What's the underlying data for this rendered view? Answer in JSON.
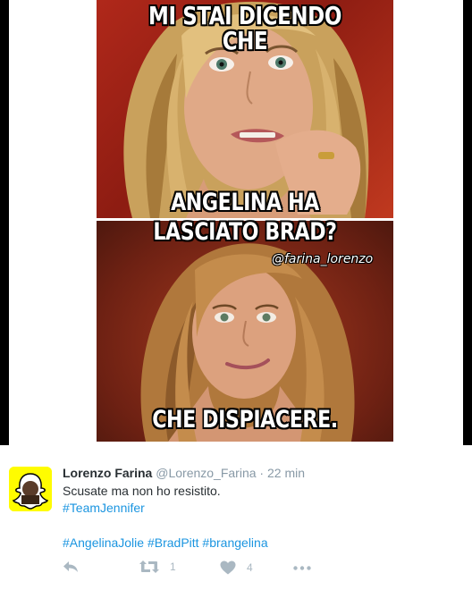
{
  "meme": {
    "caption_top": "MI STAI DICENDO CHE",
    "caption_mid_1": "ANGELINA HA",
    "caption_mid_2": "LASCIATO BRAD?",
    "caption_bottom": "CHE DISPIACERE.",
    "watermark": "@farina_lorenzo"
  },
  "tweet": {
    "author_name": "Lorenzo Farina",
    "author_handle": "@Lorenzo_Farina",
    "separator": "·",
    "timestamp": "22 min",
    "text": "Scusate ma non ho resistito.",
    "hashtag_line_1": "#TeamJennifer",
    "hashtag_line_2": "#AngelinaJolie #BradPitt #brangelina",
    "avatar_icon": "snapchat-ghost-icon",
    "avatar_color": "#fffc00"
  },
  "actions": {
    "reply_icon": "reply-icon",
    "retweet_icon": "retweet-icon",
    "retweet_count": "1",
    "like_icon": "heart-icon",
    "like_count": "4",
    "more_icon": "more-dots-icon"
  },
  "colors": {
    "link": "#1b95e0",
    "muted": "#8899a6",
    "icon": "#aab8c2",
    "text": "#292f33"
  }
}
